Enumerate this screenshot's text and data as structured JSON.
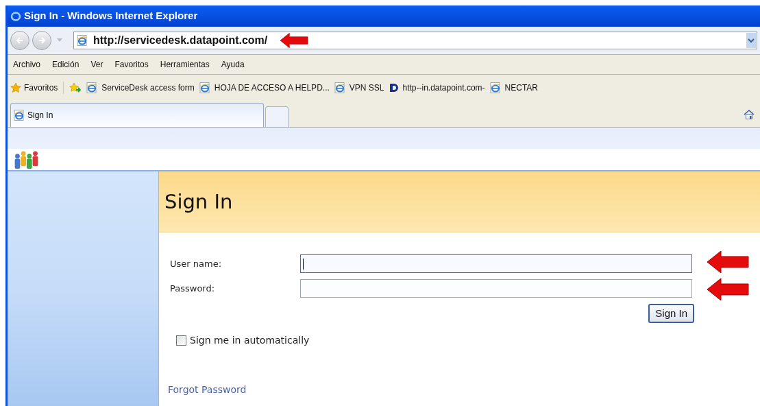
{
  "window": {
    "title": "Sign In - Windows Internet Explorer"
  },
  "address_bar": {
    "value": "http://servicedesk.datapoint.com/"
  },
  "menu": [
    "Archivo",
    "Edición",
    "Ver",
    "Favoritos",
    "Herramientas",
    "Ayuda"
  ],
  "favorites_bar": {
    "label": "Favoritos",
    "items": [
      {
        "label": "ServiceDesk access form",
        "kind": "ie"
      },
      {
        "label": "HOJA DE ACCESO A HELPD...",
        "kind": "ie"
      },
      {
        "label": "VPN SSL",
        "kind": "ie"
      },
      {
        "label": "http--in.datapoint.com-",
        "kind": "d"
      },
      {
        "label": "NECTAR",
        "kind": "ie"
      }
    ]
  },
  "tabs": [
    {
      "label": "Sign In",
      "selected": true
    }
  ],
  "page": {
    "heading": "Sign In",
    "fields": [
      {
        "label": "User name:",
        "focused": true
      },
      {
        "label": "Password:",
        "focused": false
      }
    ],
    "submit": "Sign In",
    "remember": {
      "label": "Sign me in automatically",
      "checked": false
    },
    "forgot_link": "Forgot Password"
  }
}
